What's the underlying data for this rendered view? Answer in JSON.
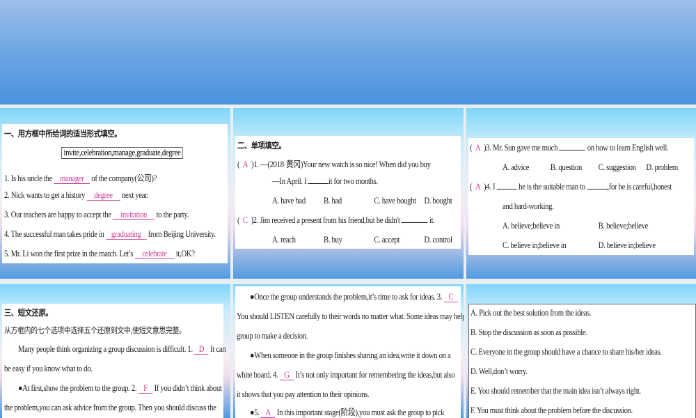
{
  "s1": {
    "title": "一、用方框中所给词的适当形式填空。",
    "wordbox": "invite,celebration,manage,graduate,degree",
    "items": [
      {
        "pre": "1. Is his uncle the",
        "ans": "manager",
        "post": "of the company(公司)?"
      },
      {
        "pre": "2. Nick wants to get a history",
        "ans": "degree",
        "post": "next year."
      },
      {
        "pre": "3. Our teachers are happy to accept the",
        "ans": "invitation",
        "post": "to the party."
      },
      {
        "pre": "4. The successful man takes pride in",
        "ans": "graduating",
        "post": "from Beijing University."
      },
      {
        "pre": "5. Mr. Li won the first prize in the match. Let’s",
        "ans": "celebrate",
        "post": "it,OK?"
      }
    ]
  },
  "s2": {
    "title": "二、单项填空。",
    "q1": {
      "ans": "A",
      "text": ")1. —(2018·黄冈)Your new watch is so nice! When did you buy",
      "line2a": "—In April. I",
      "line2b": "it for two months.",
      "opts": [
        "A. have had",
        "B. had",
        "C. have bought",
        "D. bought"
      ]
    },
    "q2": {
      "ans": "C",
      "text": ")2. Jim received a present from his friend,but he didn't",
      "end": "it.",
      "opts": [
        "A. reach",
        "B. buy",
        "C. accept",
        "D. control"
      ]
    }
  },
  "s3": {
    "q3": {
      "ans": "A",
      "pre": ")3. Mr. Sun gave me much",
      "post": "on how to learn English well.",
      "opts": [
        "A. advice",
        "B. question",
        "C. suggestion",
        "D. problem"
      ]
    },
    "q4": {
      "ans": "A",
      "pre": ")4. I",
      "mid": "he is the suitable man to",
      "post": ",for he is careful,honest",
      "line2": "and hard-working.",
      "opts": [
        "A. believe;believe in",
        "B. believe;believe",
        "C. believe in;believe in",
        "D. believe in;believe"
      ]
    }
  },
  "s4": {
    "title": "三、短文还原。",
    "instr": "从方框内的七个选项中选择五个还原到文中,使短文意思完整。",
    "p1a": "Many people think organizing a group discussion is difficult. 1.",
    "a1": "D",
    "p1b": "It can",
    "p1c": "be easy if you know what to do.",
    "p2a": "●At first,show the problem to the group. 2.",
    "a2": "F",
    "p2b": "If you didn’t think about",
    "p2c": "the problem,you can ask advice from the group. Then you should discuss the"
  },
  "s5": {
    "l1a": "●Once the group understands the problem,it’s time to ask for ideas. 3.",
    "a3": "C",
    "l2": "You should LISTEN carefully to their words no matter what. Some ideas may help the",
    "l3": "group to make a decision.",
    "l4": "●When someone in the group finishes sharing an idea,write it down on a",
    "l5a": "white board. 4.",
    "a4": "G",
    "l5b": "It’s not only important for remembering the ideas,but also",
    "l6": "it shows that you pay attention to their opinions.",
    "l7a": "●5.",
    "a5": "A",
    "l7b": "In this important stage(阶段),you must ask the group to pick"
  },
  "s6": {
    "options": [
      "A. Pick out the best solution from the ideas.",
      "B. Stop the discussion as soon as possible.",
      "C. Everyone in the group should have a chance to share his/her ideas.",
      "D. Well,don’t worry.",
      "E. You should remember that the main idea isn’t always right.",
      "F. You must think about the problem before the discussion."
    ]
  }
}
